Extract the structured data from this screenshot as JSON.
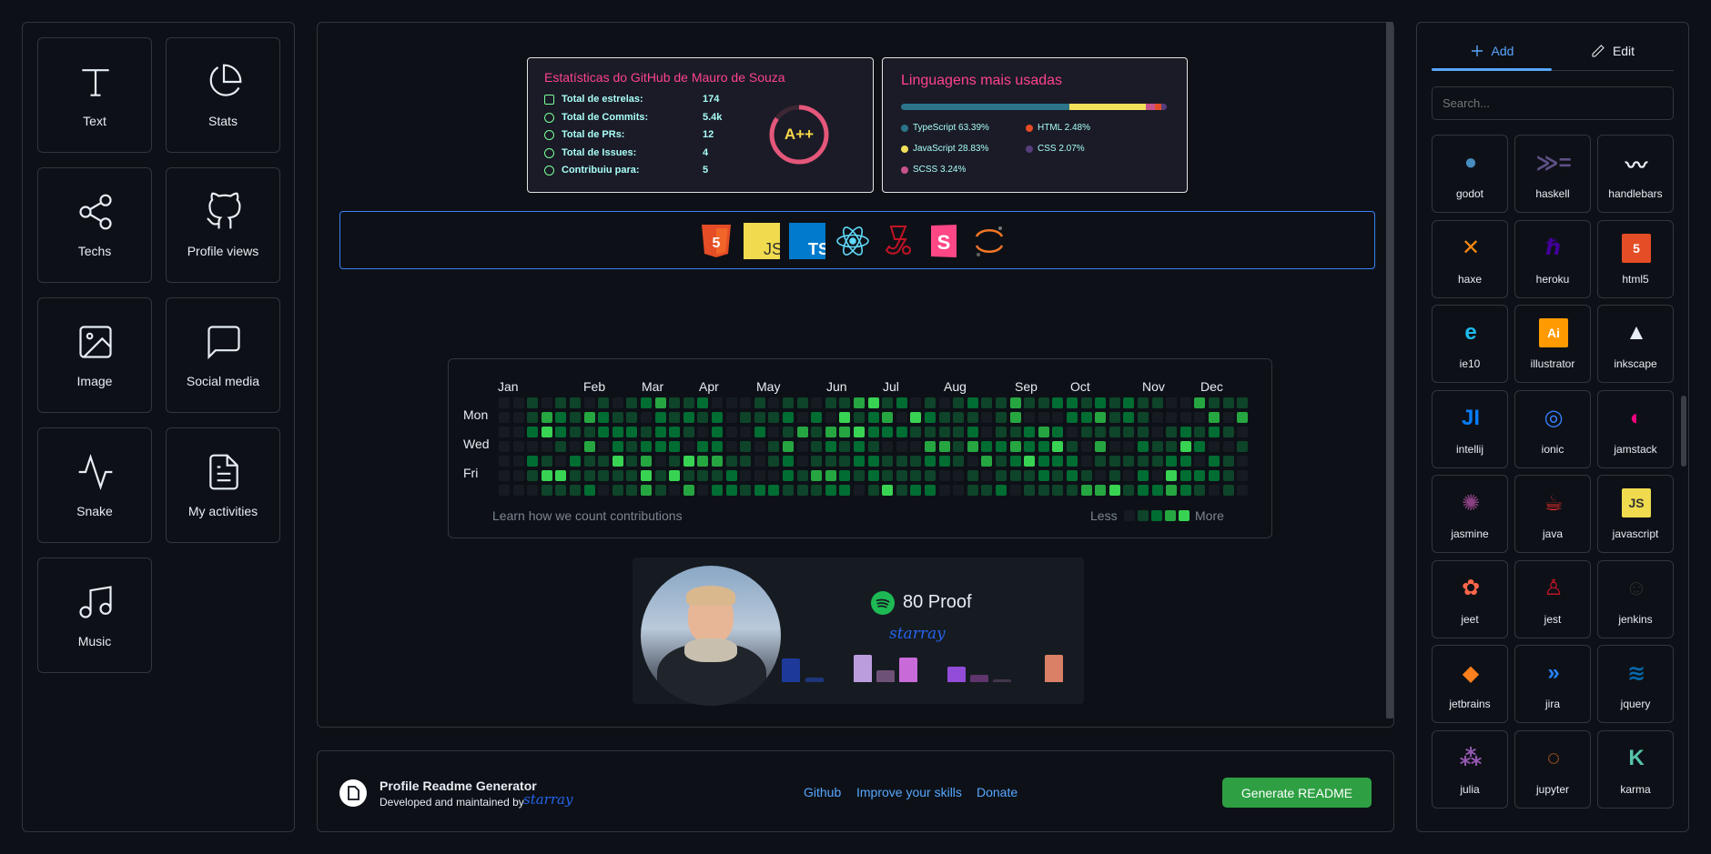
{
  "left_panel": {
    "tiles": [
      {
        "label": "Text",
        "icon": "text-icon"
      },
      {
        "label": "Stats",
        "icon": "pie-chart-icon"
      },
      {
        "label": "Techs",
        "icon": "share-icon"
      },
      {
        "label": "Profile views",
        "icon": "github-icon"
      },
      {
        "label": "Image",
        "icon": "image-icon"
      },
      {
        "label": "Social media",
        "icon": "message-square-icon"
      },
      {
        "label": "Snake",
        "icon": "activity-icon"
      },
      {
        "label": "My activities",
        "icon": "file-text-icon"
      },
      {
        "label": "Music",
        "icon": "music-icon"
      }
    ]
  },
  "stats_card": {
    "title": "Estatísticas do GitHub de Mauro de Souza",
    "rows": [
      {
        "label": "Total de estrelas:",
        "value": "174",
        "icon": "star-icon"
      },
      {
        "label": "Total de Commits:",
        "value": "5.4k",
        "icon": "history-icon"
      },
      {
        "label": "Total de PRs:",
        "value": "12",
        "icon": "pull-request-icon"
      },
      {
        "label": "Total de Issues:",
        "value": "4",
        "icon": "issue-icon"
      },
      {
        "label": "Contribuiu para:",
        "value": "5",
        "icon": "repo-icon"
      }
    ],
    "grade": "A++",
    "ring_color": "#e4577a"
  },
  "langs_card": {
    "title": "Linguagens mais usadas",
    "languages": [
      {
        "name": "TypeScript 63.39%",
        "pct": 63.39,
        "color": "#2b7489"
      },
      {
        "name": "HTML 2.48%",
        "pct": 2.48,
        "color": "#e34c26"
      },
      {
        "name": "JavaScript 28.83%",
        "pct": 28.83,
        "color": "#f1e05a"
      },
      {
        "name": "CSS 2.07%",
        "pct": 2.07,
        "color": "#563d7c"
      },
      {
        "name": "SCSS 3.24%",
        "pct": 3.24,
        "color": "#c6538c"
      }
    ]
  },
  "techs": [
    "html5-icon",
    "javascript-icon",
    "typescript-icon",
    "react-icon",
    "jest-icon",
    "storybook-icon",
    "jupyter-icon"
  ],
  "contributions": {
    "months": [
      "Jan",
      "Feb",
      "Mar",
      "Apr",
      "May",
      "Jun",
      "Jul",
      "Aug",
      "Sep",
      "Oct",
      "Nov",
      "Dec"
    ],
    "days": [
      "Mon",
      "Wed",
      "Fri"
    ],
    "footer_left": "Learn how we count contributions",
    "less": "Less",
    "more": "More"
  },
  "music": {
    "track": "80 Proof",
    "artist": "starray",
    "spotify_color": "#1db954"
  },
  "footer": {
    "title": "Profile Readme Generator",
    "subtitle": "Developed and maintained by",
    "signature": "starray",
    "links": [
      "Github",
      "Improve your skills",
      "Donate"
    ],
    "generate_label": "Generate README",
    "generate_color": "#2ea043"
  },
  "right_panel": {
    "tabs": [
      {
        "label": "Add",
        "icon": "plus-icon"
      },
      {
        "label": "Edit",
        "icon": "pen-icon"
      }
    ],
    "search_placeholder": "Search...",
    "icons": [
      "godot",
      "haskell",
      "handlebars",
      "haxe",
      "heroku",
      "html5",
      "ie10",
      "illustrator",
      "inkscape",
      "intellij",
      "ionic",
      "jamstack",
      "jasmine",
      "java",
      "javascript",
      "jeet",
      "jest",
      "jenkins",
      "jetbrains",
      "jira",
      "jquery",
      "julia",
      "jupyter",
      "karma"
    ]
  }
}
